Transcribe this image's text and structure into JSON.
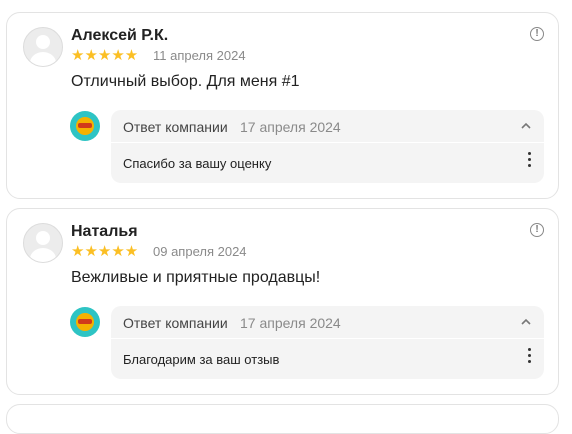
{
  "reviews": [
    {
      "author": "Алексей Р.К.",
      "stars": "★★★★★",
      "date": "11 апреля 2024",
      "text": "Отличный выбор. Для меня #1",
      "reply": {
        "author": "Ответ компании",
        "date": "17 апреля 2024",
        "text": "Спасибо за вашу оценку"
      }
    },
    {
      "author": "Наталья",
      "stars": "★★★★★",
      "date": "09 апреля 2024",
      "text": "Вежливые и приятные продавцы!",
      "reply": {
        "author": "Ответ компании",
        "date": "17 апреля 2024",
        "text": "Благодарим за ваш отзыв"
      }
    }
  ],
  "rating_value": 5,
  "rating_max": 5,
  "colors": {
    "star": "#fbbf24",
    "logo_bg": "#2ec4c4",
    "reply_bg": "#f4f4f4"
  },
  "icons": {
    "info": "info-icon",
    "chevron": "chevron-up-icon",
    "more": "more-vertical-icon",
    "avatar": "user-avatar-icon",
    "company_logo": "company-logo-icon"
  }
}
